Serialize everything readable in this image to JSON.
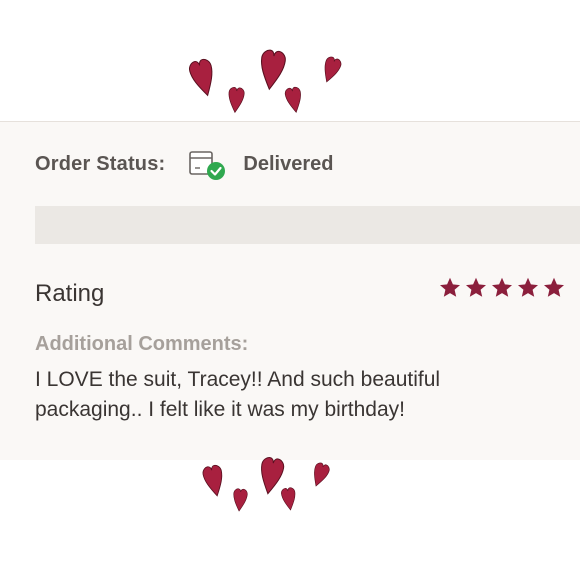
{
  "order": {
    "label": "Order Status:",
    "status": "Delivered",
    "status_icon": "box-delivered-icon"
  },
  "rating": {
    "label": "Rating",
    "stars": 5,
    "max_stars": 5
  },
  "comments": {
    "label": "Additional Comments:",
    "text": "I LOVE the suit, Tracey!! And such beautiful packaging.. I felt like it was my birthday!"
  },
  "colors": {
    "heart": "#a8203f",
    "star": "#8b1f3c",
    "check": "#2fa84f",
    "label": "#5a5552",
    "muted_label": "#a6a09b",
    "text": "#3a3533",
    "card_bg": "#faf8f6",
    "band_bg": "#ebe8e4"
  }
}
